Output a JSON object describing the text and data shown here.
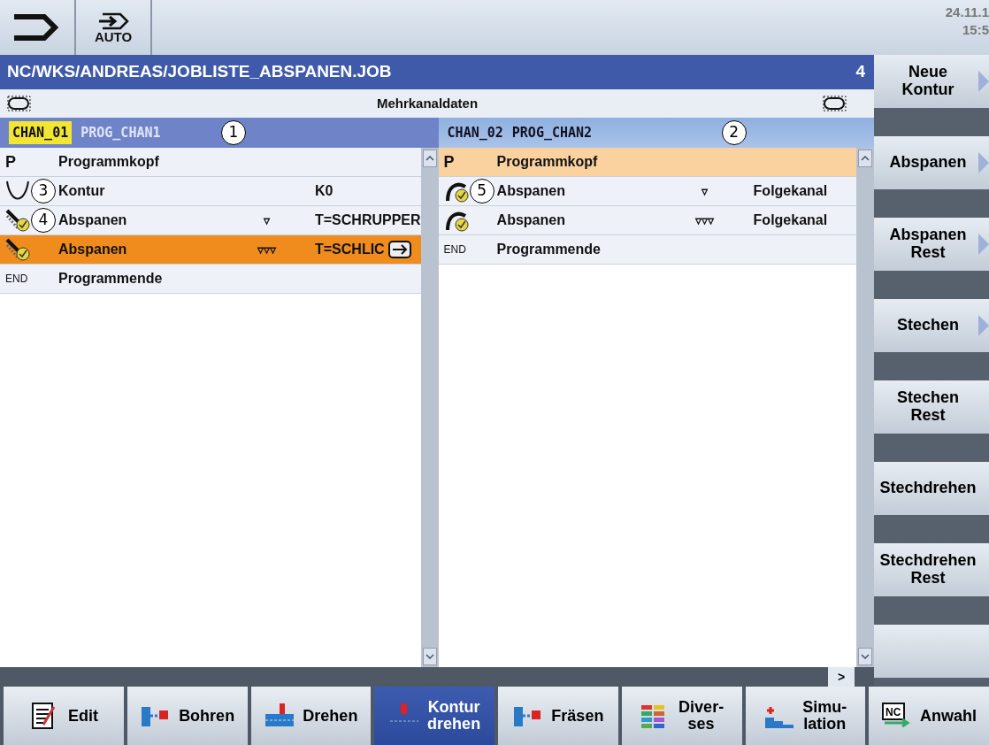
{
  "header": {
    "mode_label": "AUTO",
    "date": "24.11.1",
    "time": "15:5"
  },
  "title_bar": {
    "path": "NC/WKS/ANDREAS/JOBLISTE_ABSPANEN.JOB",
    "channel_count": "4"
  },
  "subheader": {
    "title": "Mehrkanaldaten"
  },
  "panels": [
    {
      "channel": "CHAN_01",
      "program": "PROG_CHAN1",
      "active": true,
      "callout": "1",
      "rows": [
        {
          "kind": "header",
          "icon_text": "P",
          "name": "Programmkopf",
          "marks": "",
          "value": "",
          "selected": false
        },
        {
          "kind": "contour",
          "name": "Kontur",
          "marks": "",
          "value": "K0",
          "selected": false,
          "callout": "3"
        },
        {
          "kind": "roughing",
          "name": "Abspanen",
          "marks": "▿",
          "value": "T=SCHRUPPER",
          "selected": false,
          "callout": "4"
        },
        {
          "kind": "roughing",
          "name": "Abspanen",
          "marks": "▿▿▿",
          "value": "T=SCHLIC",
          "selected": true
        },
        {
          "kind": "end",
          "icon_text": "END",
          "name": "Programmende",
          "marks": "",
          "value": "",
          "selected": false
        }
      ]
    },
    {
      "channel": "CHAN_02",
      "program": "PROG_CHAN2",
      "active": false,
      "callout": "2",
      "rows": [
        {
          "kind": "header",
          "icon_text": "P",
          "name": "Programmkopf",
          "marks": "",
          "value": "",
          "selected": true
        },
        {
          "kind": "follow",
          "name": "Abspanen",
          "marks": "▿",
          "value": "Folgekanal",
          "selected": false,
          "callout": "5"
        },
        {
          "kind": "follow",
          "name": "Abspanen",
          "marks": "▿▿▿",
          "value": "Folgekanal",
          "selected": false
        },
        {
          "kind": "end",
          "icon_text": "END",
          "name": "Programmende",
          "marks": "",
          "value": "",
          "selected": false
        }
      ]
    }
  ],
  "more_button": ">",
  "vertical_softkeys": [
    {
      "label": "Neue\nKontur",
      "arrow": true
    },
    {
      "label": "Abspanen",
      "arrow": true
    },
    {
      "label": "Abspanen\nRest",
      "arrow": true
    },
    {
      "label": "Stechen",
      "arrow": true
    },
    {
      "label": "Stechen\nRest",
      "arrow": false
    },
    {
      "label": "Stechdrehen",
      "arrow": false
    },
    {
      "label": "Stechdrehen\nRest",
      "arrow": false
    },
    {
      "arrow": false
    }
  ],
  "horizontal_softkeys": [
    {
      "kind": "edit",
      "label": "Edit",
      "selected": false
    },
    {
      "kind": "drill",
      "label": "Bohren",
      "selected": false
    },
    {
      "kind": "turn",
      "label": "Drehen",
      "selected": false
    },
    {
      "kind": "contour",
      "label": "Kontur\ndrehen",
      "selected": true
    },
    {
      "kind": "drill",
      "label": "Fräsen",
      "selected": false
    },
    {
      "kind": "misc",
      "label": "Diver-\nses",
      "selected": false
    },
    {
      "kind": "sim",
      "label": "Simu-\nlation",
      "selected": false
    },
    {
      "kind": "nc",
      "icon_text": "NC",
      "label": "Anwahl",
      "selected": false
    }
  ]
}
